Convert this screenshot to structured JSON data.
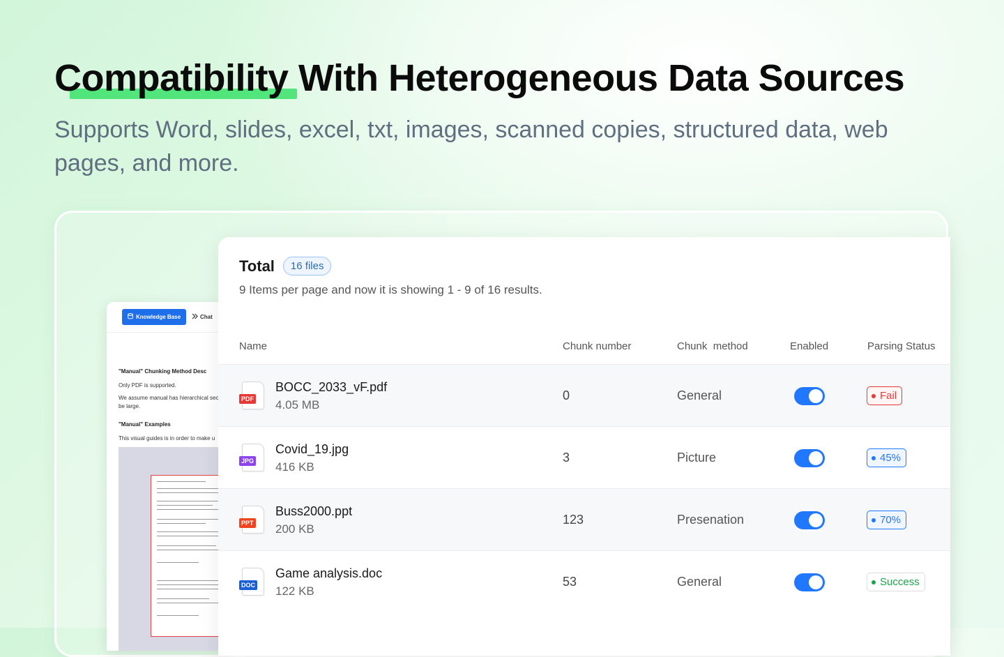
{
  "hero": {
    "title_highlight": "Compatibility",
    "title_rest": " With Heterogeneous Data Sources",
    "subtitle": "Supports Word, slides, excel, txt, images, scanned copies, structured data, web pages, and more."
  },
  "back_panel": {
    "nav_knowledge_base": "Knowledge Base",
    "nav_chat": "Chat",
    "doc_title": "\"Manual\" Chunking Method Desc",
    "doc_line1": "Only PDF is supported.",
    "doc_line2": "We assume manual has hierarchical sec",
    "doc_line3": "be large.",
    "examples_title": "\"Manual\" Examples",
    "examples_line": "This visual guides is in order to make u"
  },
  "table": {
    "total_label": "Total",
    "files_badge": "16 files",
    "page_info": "9 Items per page and now it is showing 1 - 9 of 16 results.",
    "columns": {
      "name": "Name",
      "chunk_number": "Chunk number",
      "chunk_method": "Chunk  method",
      "enabled": "Enabled",
      "parsing_status": "Parsing Status"
    },
    "rows": [
      {
        "name": "BOCC_2033_vF.pdf",
        "size": "4.05 MB",
        "type": "PDF",
        "type_color": "#e53935",
        "chunks": "0",
        "method": "General",
        "enabled": true,
        "status": "Fail",
        "status_color": "#e53935",
        "status_bg": "#fff5f5"
      },
      {
        "name": "Covid_19.jpg",
        "size": "416 KB",
        "type": "JPG",
        "type_color": "#8e44ec",
        "chunks": "3",
        "method": "Picture",
        "enabled": true,
        "status": "45%",
        "status_color": "#1f78ff",
        "status_bg": "#f0f6ff"
      },
      {
        "name": "Buss2000.ppt",
        "size": "200 KB",
        "type": "PPT",
        "type_color": "#f0441f",
        "chunks": "123",
        "method": "Presenation",
        "enabled": true,
        "status": "70%",
        "status_color": "#1f78ff",
        "status_bg": "#f0f6ff"
      },
      {
        "name": "Game analysis.doc",
        "size": "122 KB",
        "type": "DOC",
        "type_color": "#1b5fd6",
        "chunks": "53",
        "method": "General",
        "enabled": true,
        "status": "Success",
        "status_color": "#1aa34a",
        "status_bg": "#ffffff"
      }
    ]
  },
  "colors": {
    "accent": "#1f78ff",
    "highlight": "#52e57c",
    "fail": "#e53935",
    "success": "#1aa34a"
  },
  "icons": [
    "database-icon",
    "chat-icon",
    "file-icon"
  ]
}
